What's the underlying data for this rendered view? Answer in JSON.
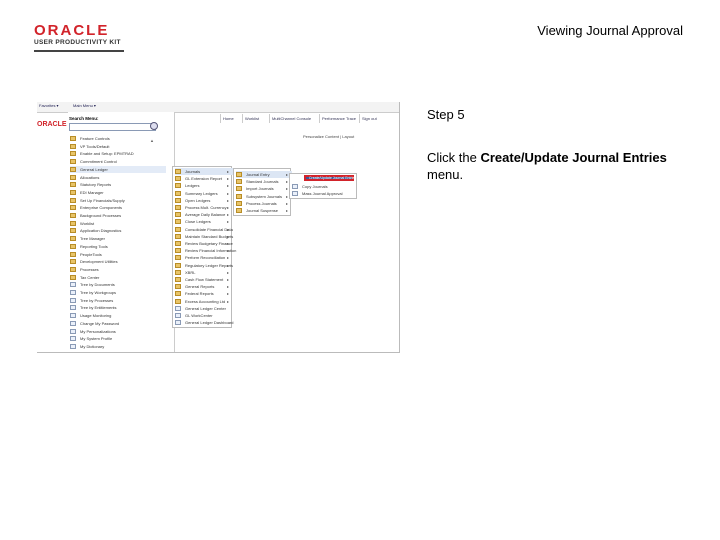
{
  "logo": {
    "brand": "ORACLE",
    "product": "USER PRODUCTIVITY KIT"
  },
  "page_title": "Viewing Journal Approval",
  "step": {
    "title": "Step 5",
    "instruction_prefix": "Click the ",
    "instruction_bold": "Create/Update Journal Entries",
    "instruction_suffix": " menu."
  },
  "screenshot": {
    "topbar": {
      "favorites": "Favorites ▾",
      "main_menu": "Main Menu ▾"
    },
    "header_brand": "ORACLE",
    "top_links": [
      "Home",
      "Worklist",
      "MultiChannel Console",
      "Performance Trace",
      "Sign out"
    ],
    "personalize": "Personalize Content | Layout",
    "search_label": "Search Menu:",
    "scroll_up": "▲",
    "scroll_down": "▼",
    "go": "»",
    "menu1": [
      {
        "label": "Feature Controls",
        "icon": "folder"
      },
      {
        "label": "VP Tools/Default",
        "icon": "folder"
      },
      {
        "label": "Enable and Setup: EPMTRAD",
        "icon": "folder"
      },
      {
        "label": "Commitment Control",
        "icon": "folder"
      },
      {
        "label": "General Ledger",
        "icon": "folder",
        "selected": true
      },
      {
        "label": "Allocations",
        "icon": "folder"
      },
      {
        "label": "Statutory Reports",
        "icon": "folder"
      },
      {
        "label": "EDI Manager",
        "icon": "folder"
      },
      {
        "label": "Set Up Financials/Supply",
        "icon": "folder"
      },
      {
        "label": "Enterprise Components",
        "icon": "folder"
      },
      {
        "label": "Background Processes",
        "icon": "folder"
      },
      {
        "label": "Worklist",
        "icon": "folder"
      },
      {
        "label": "Application Diagnostics",
        "icon": "folder"
      },
      {
        "label": "Tree Manager",
        "icon": "folder"
      },
      {
        "label": "Reporting Tools",
        "icon": "folder"
      },
      {
        "label": "PeopleTools",
        "icon": "folder"
      },
      {
        "label": "Development Utilities",
        "icon": "folder"
      },
      {
        "label": "Processes",
        "icon": "folder"
      },
      {
        "label": "Tax Center",
        "icon": "folder"
      },
      {
        "label": "Tree by Documents",
        "icon": "doc"
      },
      {
        "label": "Tree by Workgroups",
        "icon": "doc"
      },
      {
        "label": "Tree by Processes",
        "icon": "doc"
      },
      {
        "label": "Tree by Entitlements",
        "icon": "doc"
      },
      {
        "label": "Usage Monitoring",
        "icon": "doc"
      },
      {
        "label": "Change My Password",
        "icon": "doc"
      },
      {
        "label": "My Personalizations",
        "icon": "doc"
      },
      {
        "label": "My System Profile",
        "icon": "doc"
      },
      {
        "label": "My Dictionary",
        "icon": "doc"
      }
    ],
    "menu2": [
      {
        "label": "Journals",
        "icon": "folder",
        "arrow": true,
        "selected": true
      },
      {
        "label": "GL Extension Report",
        "icon": "folder",
        "arrow": true
      },
      {
        "label": "Ledgers",
        "icon": "folder",
        "arrow": true
      },
      {
        "label": "Summary Ledgers",
        "icon": "folder",
        "arrow": true
      },
      {
        "label": "Open Ledgers",
        "icon": "folder",
        "arrow": true
      },
      {
        "label": "Process Mult. Currency",
        "icon": "folder",
        "arrow": true
      },
      {
        "label": "Average Daily Balance",
        "icon": "folder",
        "arrow": true
      },
      {
        "label": "Close Ledgers",
        "icon": "folder",
        "arrow": true
      },
      {
        "label": "Consolidate Financial Data",
        "icon": "folder",
        "arrow": true
      },
      {
        "label": "Maintain Standard Budgets",
        "icon": "folder",
        "arrow": true
      },
      {
        "label": "Review Budgetary Finance",
        "icon": "folder",
        "arrow": true
      },
      {
        "label": "Review Financial Information",
        "icon": "folder",
        "arrow": true
      },
      {
        "label": "Perform Reconciliation",
        "icon": "folder",
        "arrow": true
      },
      {
        "label": "Regulatory Ledger Reports",
        "icon": "folder",
        "arrow": true
      },
      {
        "label": "XBRL",
        "icon": "folder",
        "arrow": true
      },
      {
        "label": "Cash Flow Statement",
        "icon": "folder",
        "arrow": true
      },
      {
        "label": "General Reports",
        "icon": "folder",
        "arrow": true
      },
      {
        "label": "Federal Reports",
        "icon": "folder",
        "arrow": true
      },
      {
        "label": "Excess Accounting Ltd",
        "icon": "folder",
        "arrow": true
      },
      {
        "label": "General Ledger Center",
        "icon": "doc",
        "arrow": false
      },
      {
        "label": "GL WorkCenter",
        "icon": "doc",
        "arrow": false
      },
      {
        "label": "General Ledger Dashboard",
        "icon": "doc",
        "arrow": false
      }
    ],
    "menu3": [
      {
        "label": "Journal Entry",
        "icon": "folder",
        "arrow": true,
        "selected": true
      },
      {
        "label": "Standard Journals",
        "icon": "folder",
        "arrow": true
      },
      {
        "label": "Import Journals",
        "icon": "folder",
        "arrow": true
      },
      {
        "label": "Subsystem Journals",
        "icon": "folder",
        "arrow": true
      },
      {
        "label": "Process Journals",
        "icon": "folder",
        "arrow": true
      },
      {
        "label": "Journal Suspense",
        "icon": "folder",
        "arrow": true
      }
    ],
    "menu4": [
      {
        "label": "Create/Update Journal Entries",
        "icon": "doc",
        "highlighted": true
      },
      {
        "label": "Copy Journals",
        "icon": "doc"
      },
      {
        "label": "Mass Journal Approval",
        "icon": "doc"
      }
    ]
  }
}
